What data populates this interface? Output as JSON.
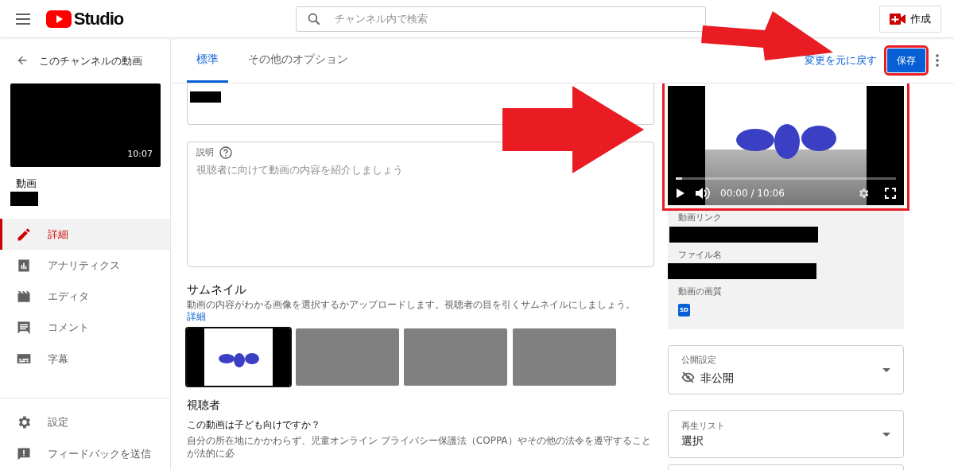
{
  "header": {
    "brand": "Studio",
    "search_placeholder": "チャンネル内で検索",
    "create_button": "作成"
  },
  "sidebar": {
    "back_label": "このチャンネルの動画",
    "duration": "10:07",
    "video_label": "動画",
    "items": [
      {
        "label": "詳細",
        "kind": "details",
        "selected": true
      },
      {
        "label": "アナリティクス",
        "kind": "analytics",
        "selected": false
      },
      {
        "label": "エディタ",
        "kind": "editor",
        "selected": false
      },
      {
        "label": "コメント",
        "kind": "comments",
        "selected": false
      },
      {
        "label": "字幕",
        "kind": "subtitles",
        "selected": false
      }
    ],
    "footer_items": [
      {
        "label": "設定",
        "kind": "settings"
      },
      {
        "label": "フィードバックを送信",
        "kind": "feedback"
      }
    ]
  },
  "tabs": [
    {
      "label": "標準",
      "selected": true
    },
    {
      "label": "その他のオプション",
      "selected": false
    }
  ],
  "actions": {
    "undo_link": "変更を元に戻す",
    "save_button": "保存"
  },
  "description": {
    "label": "説明",
    "placeholder": "視聴者に向けて動画の内容を紹介しましょう"
  },
  "thumbnail": {
    "title": "サムネイル",
    "hint": "動画の内容がわかる画像を選択するかアップロードします。視聴者の目を引くサムネイルにしましょう。",
    "link": "詳細",
    "options": [
      {
        "kind": "picture",
        "selected": true
      },
      {
        "kind": "blank",
        "selected": false
      },
      {
        "kind": "blank",
        "selected": false
      },
      {
        "kind": "blank",
        "selected": false
      }
    ]
  },
  "audience": {
    "title": "視聴者",
    "question": "この動画は子ども向けですか？",
    "text": "自分の所在地にかかわらず、児童オンライン プライバシー保護法（COPPA）やその他の法令を遵守することが法的に必"
  },
  "player": {
    "time": "00:00 / 10:06",
    "level": 0.03
  },
  "info": [
    {
      "label": "動画リンク",
      "kind": "redacted"
    },
    {
      "label": "ファイル名",
      "kind": "redacted"
    },
    {
      "label": "動画の画質",
      "kind": "badge",
      "badge": "SD"
    }
  ],
  "visibility": {
    "label": "公開設定",
    "value": "非公開"
  },
  "playlist": {
    "label": "再生リスト",
    "value": "選択"
  }
}
